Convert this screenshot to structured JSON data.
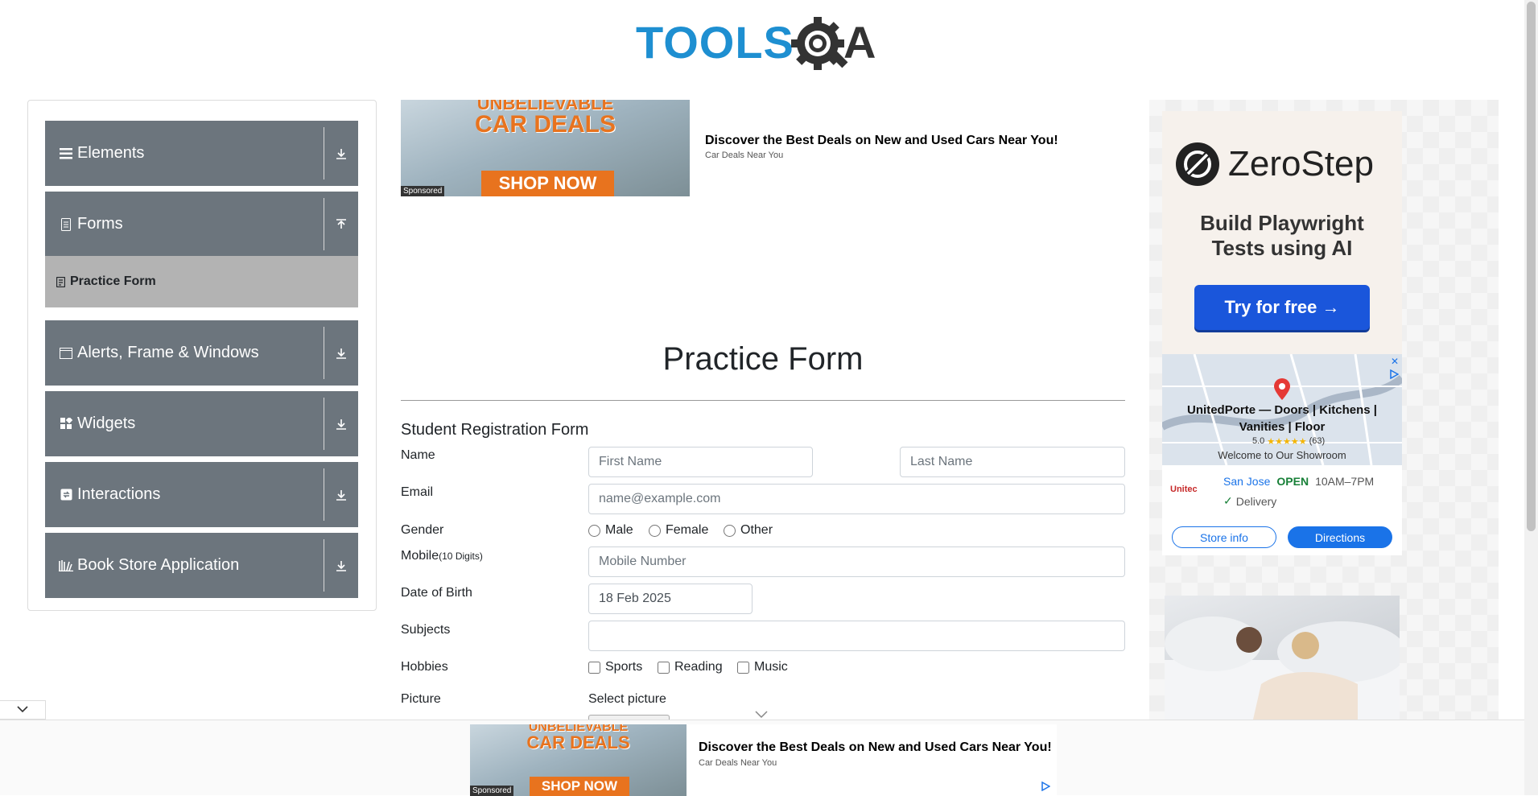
{
  "header": {
    "logo_text": "TOOLSQA",
    "colors": {
      "logo_blue": "#1e8fd1",
      "logo_dark": "#333333"
    }
  },
  "sidebar": {
    "groups": [
      {
        "label": "Elements",
        "icon": "hamburger-icon",
        "arrow": "download-arrow-icon"
      },
      {
        "label": "Forms",
        "icon": "document-icon",
        "arrow": "upload-arrow-icon",
        "expanded": true,
        "items": [
          {
            "label": "Practice Form",
            "icon": "form-icon",
            "active": true
          }
        ]
      },
      {
        "label": "Alerts, Frame & Windows",
        "icon": "window-icon",
        "arrow": "download-arrow-icon"
      },
      {
        "label": "Widgets",
        "icon": "widgets-icon",
        "arrow": "download-arrow-icon"
      },
      {
        "label": "Interactions",
        "icon": "interactions-icon",
        "arrow": "download-arrow-icon"
      },
      {
        "label": "Book Store Application",
        "icon": "books-icon",
        "arrow": "download-arrow-icon"
      }
    ],
    "colors": {
      "group_bg": "#6c757d",
      "active_bg": "#b3b3b3"
    }
  },
  "ad_top": {
    "image_headline_1": "UNBELIEVABLE",
    "image_headline_2": "CAR DEALS",
    "image_button": "SHOP NOW",
    "sponsored": "Sponsored",
    "title": "Discover the Best Deals on New and Used Cars Near You!",
    "subtitle": "Car Deals Near You"
  },
  "main": {
    "page_title": "Practice Form",
    "form_title": "Student Registration Form",
    "name": {
      "label": "Name",
      "first_placeholder": "First Name",
      "last_placeholder": "Last Name"
    },
    "email": {
      "label": "Email",
      "placeholder": "name@example.com"
    },
    "gender": {
      "label": "Gender",
      "options": [
        "Male",
        "Female",
        "Other"
      ]
    },
    "mobile": {
      "label": "Mobile",
      "hint": "(10 Digits)",
      "placeholder": "Mobile Number"
    },
    "dob": {
      "label": "Date of Birth",
      "value": "18 Feb 2025"
    },
    "subjects": {
      "label": "Subjects",
      "value": ""
    },
    "hobbies": {
      "label": "Hobbies",
      "options": [
        "Sports",
        "Reading",
        "Music"
      ]
    },
    "picture": {
      "label": "Picture",
      "select_label": "Select picture"
    }
  },
  "ad_right": {
    "brand": "ZeroStep",
    "headline": "Build Playwright Tests using AI",
    "cta": "Try for free →",
    "map_title": "UnitedPorte — Doors | Kitchens | Vanities | Floor",
    "rating": "5.0",
    "rating_count": "(63)",
    "welcome": "Welcome to Our Showroom",
    "logo_snippet": "Unitec",
    "city": "San Jose",
    "status": "OPEN",
    "hours": "10AM–7PM",
    "delivery": "Delivery",
    "store_info": "Store info",
    "directions": "Directions",
    "colors": {
      "cta_blue": "#1a56db",
      "open_green": "#188038",
      "link_blue": "#1a73e8"
    }
  },
  "ad_bottom": {
    "image_headline_1": "UNBELIEVABLE",
    "image_headline_2": "CAR DEALS",
    "image_button": "SHOP NOW",
    "sponsored": "Sponsored",
    "title": "Discover the Best Deals on New and Used Cars Near You!",
    "subtitle": "Car Deals Near You"
  }
}
